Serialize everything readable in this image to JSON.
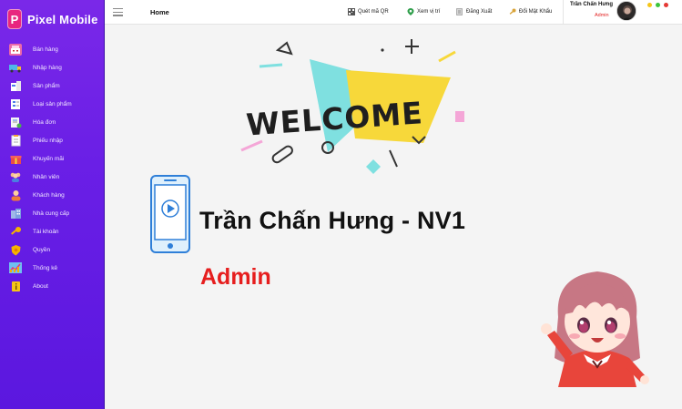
{
  "app": {
    "brand": "Pixel Mobile",
    "logo_letter": "P"
  },
  "sidebar": {
    "items": [
      {
        "label": "Bán hàng",
        "icon": "cash-register-icon"
      },
      {
        "label": "Nhập hàng",
        "icon": "truck-icon"
      },
      {
        "label": "Sản phẩm",
        "icon": "product-icon"
      },
      {
        "label": "Loại sản phẩm",
        "icon": "category-icon"
      },
      {
        "label": "Hóa đơn",
        "icon": "invoice-icon"
      },
      {
        "label": "Phiếu nhập",
        "icon": "receipt-icon"
      },
      {
        "label": "Khuyến mãi",
        "icon": "gift-icon"
      },
      {
        "label": "Nhân viên",
        "icon": "staff-icon"
      },
      {
        "label": "Khách hàng",
        "icon": "customer-icon"
      },
      {
        "label": "Nhà cung cấp",
        "icon": "supplier-icon"
      },
      {
        "label": "Tài khoản",
        "icon": "key-icon"
      },
      {
        "label": "Quyền",
        "icon": "shield-icon"
      },
      {
        "label": "Thống kê",
        "icon": "chart-icon"
      },
      {
        "label": "About",
        "icon": "info-icon"
      }
    ]
  },
  "topbar": {
    "title": "Home",
    "actions": [
      {
        "label": "Quét mã QR",
        "icon": "qr-icon"
      },
      {
        "label": "Xem vị trí",
        "icon": "map-pin-icon"
      },
      {
        "label": "Đăng Xuất",
        "icon": "logout-icon"
      },
      {
        "label": "Đổi Mật Khẩu",
        "icon": "key-icon"
      }
    ],
    "user": {
      "name": "Trần Chấn Hưng",
      "role": "Admin"
    }
  },
  "window_dots": [
    "#f5c518",
    "#3cc43c",
    "#e53935"
  ],
  "main": {
    "welcome": "WELCOME",
    "user_title": "Trần Chấn Hưng - NV1",
    "role": "Admin"
  },
  "colors": {
    "sidebar": "#6a1fe6",
    "accent_red": "#e61e1e",
    "welcome_yellow": "#f7d83a",
    "welcome_teal": "#7fe0e0"
  }
}
